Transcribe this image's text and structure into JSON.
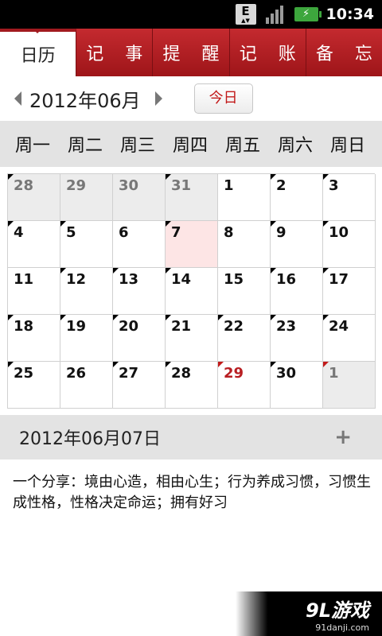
{
  "status_bar": {
    "network_badge": "E",
    "time": "10:34",
    "battery_glyph": "⚡",
    "signal_bars": 4
  },
  "tabs": [
    {
      "label": "日历",
      "active": true
    },
    {
      "label": "记 事",
      "active": false
    },
    {
      "label": "提 醒",
      "active": false
    },
    {
      "label": "记 账",
      "active": false
    },
    {
      "label": "备 忘",
      "active": false
    }
  ],
  "month_nav": {
    "month_label": "2012年06月",
    "today_label": "今日"
  },
  "weekdays": [
    "周一",
    "周二",
    "周三",
    "周四",
    "周五",
    "周六",
    "周日"
  ],
  "calendar": {
    "cells": [
      {
        "day": "28",
        "other": true,
        "marker": "black"
      },
      {
        "day": "29",
        "other": true,
        "marker": ""
      },
      {
        "day": "30",
        "other": true,
        "marker": ""
      },
      {
        "day": "31",
        "other": true,
        "marker": "black"
      },
      {
        "day": "1",
        "other": false,
        "marker": ""
      },
      {
        "day": "2",
        "other": false,
        "marker": "black"
      },
      {
        "day": "3",
        "other": false,
        "marker": "black"
      },
      {
        "day": "4",
        "other": false,
        "marker": "black"
      },
      {
        "day": "5",
        "other": false,
        "marker": "black"
      },
      {
        "day": "6",
        "other": false,
        "marker": ""
      },
      {
        "day": "7",
        "other": false,
        "marker": "black",
        "today": true
      },
      {
        "day": "8",
        "other": false,
        "marker": ""
      },
      {
        "day": "9",
        "other": false,
        "marker": "black"
      },
      {
        "day": "10",
        "other": false,
        "marker": "black"
      },
      {
        "day": "11",
        "other": false,
        "marker": ""
      },
      {
        "day": "12",
        "other": false,
        "marker": "black"
      },
      {
        "day": "13",
        "other": false,
        "marker": "black"
      },
      {
        "day": "14",
        "other": false,
        "marker": "black"
      },
      {
        "day": "15",
        "other": false,
        "marker": ""
      },
      {
        "day": "16",
        "other": false,
        "marker": "black"
      },
      {
        "day": "17",
        "other": false,
        "marker": "black"
      },
      {
        "day": "18",
        "other": false,
        "marker": "black"
      },
      {
        "day": "19",
        "other": false,
        "marker": "black"
      },
      {
        "day": "20",
        "other": false,
        "marker": "black"
      },
      {
        "day": "21",
        "other": false,
        "marker": "black"
      },
      {
        "day": "22",
        "other": false,
        "marker": "black"
      },
      {
        "day": "23",
        "other": false,
        "marker": "black"
      },
      {
        "day": "24",
        "other": false,
        "marker": "black"
      },
      {
        "day": "25",
        "other": false,
        "marker": "black"
      },
      {
        "day": "26",
        "other": false,
        "marker": ""
      },
      {
        "day": "27",
        "other": false,
        "marker": "black"
      },
      {
        "day": "28",
        "other": false,
        "marker": "black"
      },
      {
        "day": "29",
        "other": false,
        "marker": "red",
        "red": true
      },
      {
        "day": "30",
        "other": false,
        "marker": "black"
      },
      {
        "day": "1",
        "other": true,
        "marker": "red"
      }
    ]
  },
  "selected_date": {
    "label": "2012年06月07日",
    "add_label": "+"
  },
  "note": {
    "text": "一个分享：境由心造，相由心生；行为养成习惯，习惯生成性格，性格决定命运；拥有好习"
  },
  "watermark": {
    "logo": "9L游戏",
    "url": "91danji.com"
  },
  "colors": {
    "accent": "#a11a1f",
    "today_bg": "#fde5e5",
    "red_text": "#b81e22"
  }
}
